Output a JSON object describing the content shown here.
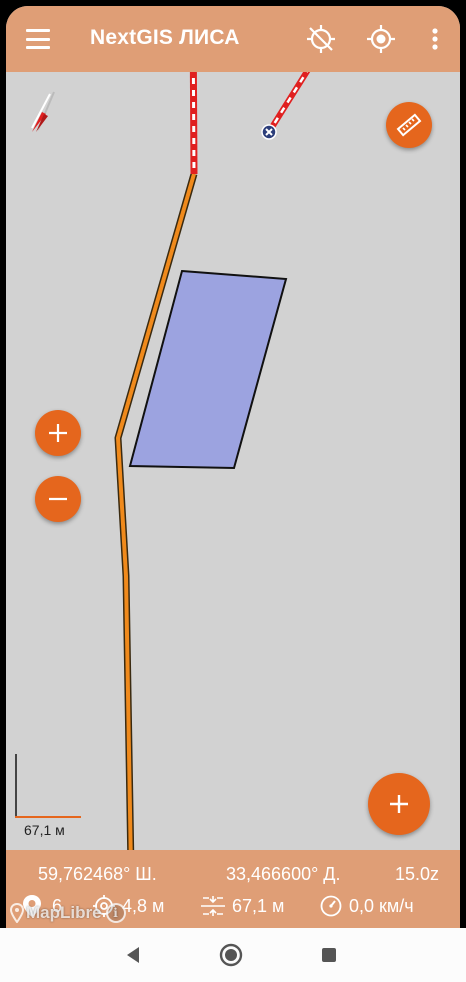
{
  "app": {
    "title": "NextGIS ЛИСА"
  },
  "appbar_icons": [
    "menu-icon",
    "gps-off-icon",
    "my-location-icon",
    "more-vert-icon"
  ],
  "map": {
    "attribution": "MapLibre",
    "scale_label": "67,1 м"
  },
  "status": {
    "latitude": "59,762468° Ш.",
    "longitude": "33,466600° Д.",
    "zoom": "15.0z",
    "satellites": "6",
    "accuracy": "4,8 м",
    "distance": "67,1 м",
    "speed": "0,0 км/ч"
  },
  "colors": {
    "appbar": "#df9e76",
    "fab": "#e5661d",
    "polygon_fill": "#9ca3e0",
    "track": "#f08a1c",
    "map_bg": "#d2d2d2"
  }
}
